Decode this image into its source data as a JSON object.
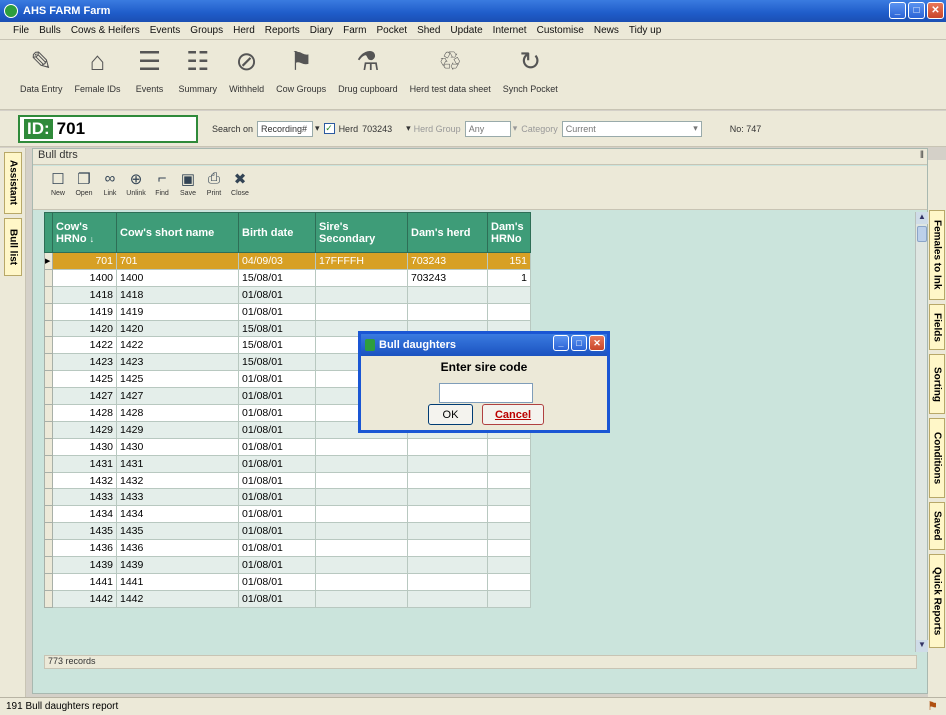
{
  "window": {
    "title": "AHS FARM Farm",
    "min": "_",
    "max": "□",
    "close": "✕"
  },
  "menu": [
    "File",
    "Bulls",
    "Cows & Heifers",
    "Events",
    "Groups",
    "Herd",
    "Reports",
    "Diary",
    "Farm",
    "Pocket",
    "Shed",
    "Update",
    "Internet",
    "Customise",
    "News",
    "Tidy up"
  ],
  "toolbar": [
    {
      "label": "Data Entry",
      "icon": "pencil-icon",
      "glyph": "✎"
    },
    {
      "label": "Female IDs",
      "icon": "barn-icon",
      "glyph": "⌂"
    },
    {
      "label": "Events",
      "icon": "list-icon",
      "glyph": "☰"
    },
    {
      "label": "Summary",
      "icon": "document-icon",
      "glyph": "☷"
    },
    {
      "label": "Withheld",
      "icon": "no-entry-icon",
      "glyph": "⊘"
    },
    {
      "label": "Cow Groups",
      "icon": "cow-groups-icon",
      "glyph": "⚑"
    },
    {
      "label": "Drug cupboard",
      "icon": "bottle-icon",
      "glyph": "⚗"
    },
    {
      "label": "Herd test data sheet",
      "icon": "herd-test-icon",
      "glyph": "♲"
    },
    {
      "label": "Synch Pocket",
      "icon": "sync-icon",
      "glyph": "↻"
    }
  ],
  "idbar": {
    "id_label": "ID:",
    "id_value": "701",
    "search_label": "Search on",
    "search_value": "Recording#",
    "herd_label": "Herd",
    "herd_value": "703243",
    "herd_group_label": "Herd Group",
    "herd_group_value": "Any",
    "category_label": "Category",
    "category_value": "Current",
    "no_label": "No: 747"
  },
  "left_tabs": [
    "Assistant",
    "Bull list"
  ],
  "right_tabs": [
    "Females to Ink",
    "Fields",
    "Sorting",
    "Conditions",
    "Saved",
    "Quick Reports"
  ],
  "panel": {
    "title": "Bull dtrs",
    "pin": "‖",
    "tools": [
      {
        "label": "New",
        "icon": "new-icon",
        "glyph": "☐"
      },
      {
        "label": "Open",
        "icon": "open-icon",
        "glyph": "❐"
      },
      {
        "label": "Link",
        "icon": "link-icon",
        "glyph": "∞"
      },
      {
        "label": "Unlink",
        "icon": "unlink-icon",
        "glyph": "⊕"
      },
      {
        "label": "Find",
        "icon": "binoculars-icon",
        "glyph": "⌐"
      },
      {
        "label": "Save",
        "icon": "save-icon",
        "glyph": "▣"
      },
      {
        "label": "Print",
        "icon": "print-icon",
        "glyph": "⎙"
      },
      {
        "label": "Close",
        "icon": "close-doc-icon",
        "glyph": "✖"
      }
    ]
  },
  "grid": {
    "columns": [
      "Cow's HRNo",
      "Cow's short name",
      "Birth date",
      "Sire's Secondary",
      "Dam's herd",
      "Dam's HRNo"
    ],
    "sort_glyph": "↓",
    "rows": [
      [
        "701",
        "701",
        "04/09/03",
        "17FFFFH",
        "703243",
        "151"
      ],
      [
        "1400",
        "1400",
        "15/08/01",
        "",
        "703243",
        "1"
      ],
      [
        "1418",
        "1418",
        "01/08/01",
        "",
        "",
        ""
      ],
      [
        "1419",
        "1419",
        "01/08/01",
        "",
        "",
        ""
      ],
      [
        "1420",
        "1420",
        "15/08/01",
        "",
        "",
        ""
      ],
      [
        "1422",
        "1422",
        "15/08/01",
        "",
        "",
        ""
      ],
      [
        "1423",
        "1423",
        "15/08/01",
        "",
        "",
        ""
      ],
      [
        "1425",
        "1425",
        "01/08/01",
        "",
        "",
        ""
      ],
      [
        "1427",
        "1427",
        "01/08/01",
        "",
        "",
        ""
      ],
      [
        "1428",
        "1428",
        "01/08/01",
        "",
        "",
        ""
      ],
      [
        "1429",
        "1429",
        "01/08/01",
        "",
        "",
        ""
      ],
      [
        "1430",
        "1430",
        "01/08/01",
        "",
        "",
        ""
      ],
      [
        "1431",
        "1431",
        "01/08/01",
        "",
        "",
        ""
      ],
      [
        "1432",
        "1432",
        "01/08/01",
        "",
        "",
        ""
      ],
      [
        "1433",
        "1433",
        "01/08/01",
        "",
        "",
        ""
      ],
      [
        "1434",
        "1434",
        "01/08/01",
        "",
        "",
        ""
      ],
      [
        "1435",
        "1435",
        "01/08/01",
        "",
        "",
        ""
      ],
      [
        "1436",
        "1436",
        "01/08/01",
        "",
        "",
        ""
      ],
      [
        "1439",
        "1439",
        "01/08/01",
        "",
        "",
        ""
      ],
      [
        "1441",
        "1441",
        "01/08/01",
        "",
        "",
        ""
      ],
      [
        "1442",
        "1442",
        "01/08/01",
        "",
        "",
        ""
      ]
    ],
    "record_count": "773 records"
  },
  "dialog": {
    "title": "Bull daughters",
    "prompt": "Enter sire code",
    "input_value": "",
    "ok_label": "OK",
    "cancel_label": "Cancel"
  },
  "status": {
    "text": "191 Bull daughters report",
    "icon": "status-icon"
  },
  "colors": {
    "title_blue": "#1f5cc9",
    "grid_header": "#3e9c78",
    "selected_row": "#d7a024",
    "panel_bg": "#cbe4dc"
  }
}
